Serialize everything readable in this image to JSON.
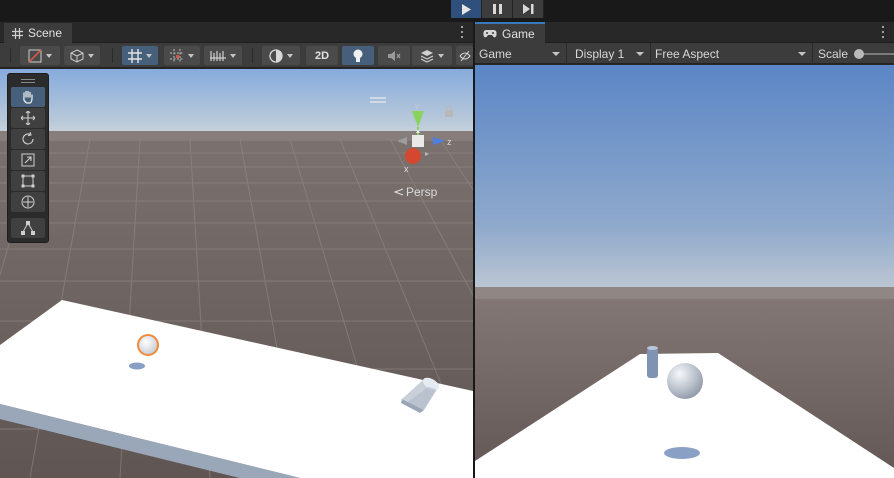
{
  "playbar": {
    "buttons": [
      {
        "name": "play-button",
        "icon": "play-icon",
        "active": true
      },
      {
        "name": "pause-button",
        "icon": "pause-icon",
        "active": false
      },
      {
        "name": "step-button",
        "icon": "step-icon",
        "active": false
      }
    ],
    "accent": "#2f4f7c"
  },
  "scene": {
    "tab_label": "Scene",
    "tab_icon": "grid-icon",
    "toolbar": {
      "draw_mode_icon": "shaded-draw-mode-icon",
      "camera_icon": "scene-camera-icon",
      "grid_icon": "grid-snap-icon",
      "increment_icon": "increment-snap-icon",
      "rulers_icon": "rulers-icon",
      "visibility_icon": "scene-visibility-icon",
      "label_2d": "2D",
      "lighting_icon": "lightbulb-icon",
      "audio_icon": "audio-mute-icon",
      "effects_icon": "effects-icon",
      "hidden_icon": "scene-hidden-icon"
    },
    "tools": [
      "hand-tool",
      "move-tool",
      "rotate-tool",
      "scale-tool",
      "rect-tool",
      "transform-tool",
      "custom-tool"
    ],
    "active_tool": "hand-tool",
    "persp_label": "Persp",
    "gizmo_axes": {
      "y": "y",
      "z": "z",
      "x": "x"
    },
    "colors": {
      "sky_top": "#7fa6d9",
      "horizon": "#c9d3dc",
      "ground": "#6a5f5c",
      "plane": "#ffffff",
      "selection": "#f08a3c"
    }
  },
  "game": {
    "tab_label": "Game",
    "tab_icon": "gamepad-icon",
    "toolbar": {
      "view_select": "Game",
      "display_select": "Display 1",
      "aspect_select": "Free Aspect",
      "scale_label": "Scale"
    },
    "colors": {
      "sky_top": "#5b86c6",
      "horizon": "#b7c4d2",
      "ground": "#665b58",
      "plane": "#ffffff"
    }
  }
}
